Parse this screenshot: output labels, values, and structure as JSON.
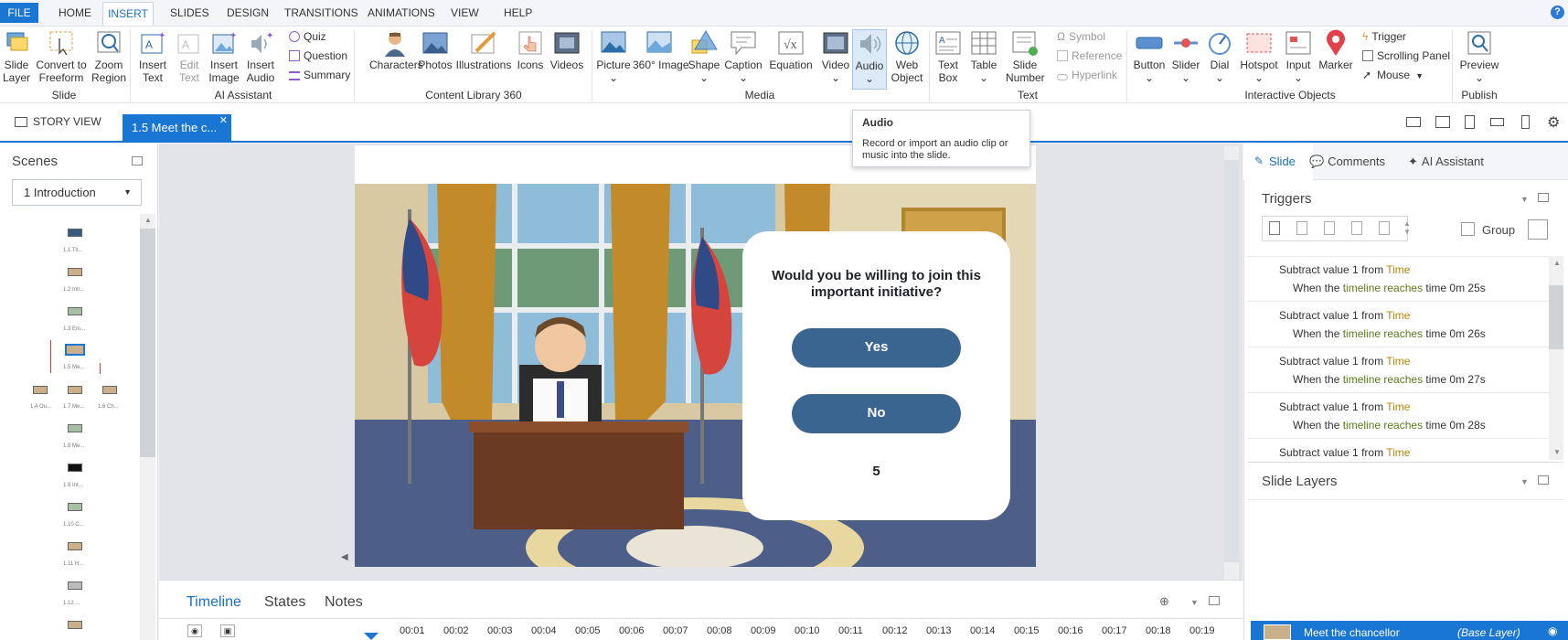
{
  "menu": {
    "items": [
      "FILE",
      "HOME",
      "INSERT",
      "SLIDES",
      "DESIGN",
      "TRANSITIONS",
      "ANIMATIONS",
      "VIEW",
      "HELP"
    ],
    "help": "?"
  },
  "ribbon": {
    "slide": {
      "slide_layer": [
        "Slide",
        "Layer"
      ],
      "convert": [
        "Convert to",
        "Freeform"
      ],
      "zoom": [
        "Zoom",
        "Region"
      ],
      "group": "Slide"
    },
    "ai": {
      "insert_text": [
        "Insert",
        "Text"
      ],
      "edit_text": [
        "Edit",
        "Text"
      ],
      "insert_image": [
        "Insert",
        "Image"
      ],
      "insert_audio": [
        "Insert",
        "Audio"
      ],
      "quiz": "Quiz",
      "question": "Question",
      "summary": "Summary",
      "group": "AI Assistant"
    },
    "library": {
      "characters": "Characters",
      "photos": "Photos",
      "illustrations": "Illustrations",
      "icons": "Icons",
      "videos": "Videos",
      "group": "Content Library 360"
    },
    "media": {
      "picture": "Picture",
      "image360": "360° Image",
      "shape": "Shape",
      "caption": "Caption",
      "equation": "Equation",
      "video": "Video",
      "audio": "Audio",
      "web_object": [
        "Web",
        "Object"
      ],
      "group": "Media"
    },
    "text": {
      "text_box": [
        "Text",
        "Box"
      ],
      "table": "Table",
      "slide_number": [
        "Slide",
        "Number"
      ],
      "symbol": "Symbol",
      "reference": "Reference",
      "hyperlink": "Hyperlink",
      "group": "Text"
    },
    "interactive": {
      "button": "Button",
      "slider": "Slider",
      "dial": "Dial",
      "hotspot": "Hotspot",
      "input": "Input",
      "marker": "Marker",
      "trigger": "Trigger",
      "scrolling_panel": "Scrolling Panel",
      "mouse": "Mouse",
      "group": "Interactive Objects"
    },
    "publish": {
      "preview": "Preview",
      "group": "Publish"
    }
  },
  "tabs": {
    "story_view": "STORY VIEW",
    "slide_tab": "1.5 Meet the c..."
  },
  "tooltip": {
    "title": "Audio",
    "description": "Record or import an audio clip or music into the slide."
  },
  "scenes": {
    "title": "Scenes",
    "selected": "1 Introduction",
    "thumb_labels": [
      "1.1 Tit...",
      "1.2 Intr...",
      "1.3 Em...",
      "1.5 Me...",
      "1.4 Ou...",
      "1.7 Me...",
      "1.6 Ch...",
      "1.8 Me...",
      "1.9 Int...",
      "1.10 C...",
      "1.11 H...",
      "1.12 ..."
    ]
  },
  "slide": {
    "question": "Would you be willing to join this important initiative?",
    "yes": "Yes",
    "no": "No",
    "counter": "5"
  },
  "right_panel": {
    "tabs": [
      "Slide",
      "Comments",
      "AI Assistant"
    ],
    "triggers_title": "Triggers",
    "group_label": "Group",
    "triggers": [
      {
        "action": [
          "Subtract value ",
          "1",
          " from ",
          "Time"
        ],
        "condition": [
          "When the ",
          "timeline reaches",
          " time ",
          "0m 25s"
        ]
      },
      {
        "action": [
          "Subtract value ",
          "1",
          " from ",
          "Time"
        ],
        "condition": [
          "When the ",
          "timeline reaches",
          " time ",
          "0m 26s"
        ]
      },
      {
        "action": [
          "Subtract value ",
          "1",
          " from ",
          "Time"
        ],
        "condition": [
          "When the ",
          "timeline reaches",
          " time ",
          "0m 27s"
        ]
      },
      {
        "action": [
          "Subtract value ",
          "1",
          " from ",
          "Time"
        ],
        "condition": [
          "When the ",
          "timeline reaches",
          " time ",
          "0m 28s"
        ]
      },
      {
        "action": [
          "Subtract value ",
          "1",
          " from ",
          "Time"
        ],
        "condition": [
          "",
          "",
          "",
          ""
        ]
      }
    ],
    "slide_layers_title": "Slide Layers",
    "layer_name": "Meet the chancellor",
    "layer_type": "(Base Layer)"
  },
  "bottom": {
    "tabs": [
      "Timeline",
      "States",
      "Notes"
    ],
    "ticks": [
      "00:01",
      "00:02",
      "00:03",
      "00:04",
      "00:05",
      "00:06",
      "00:07",
      "00:08",
      "00:09",
      "00:10",
      "00:11",
      "00:12",
      "00:13",
      "00:14",
      "00:15",
      "00:16",
      "00:17",
      "00:18",
      "00:19"
    ]
  },
  "colors": {
    "accent": "#1976d2",
    "button_fill": "#3a6591",
    "keyword": "#b8860b"
  }
}
